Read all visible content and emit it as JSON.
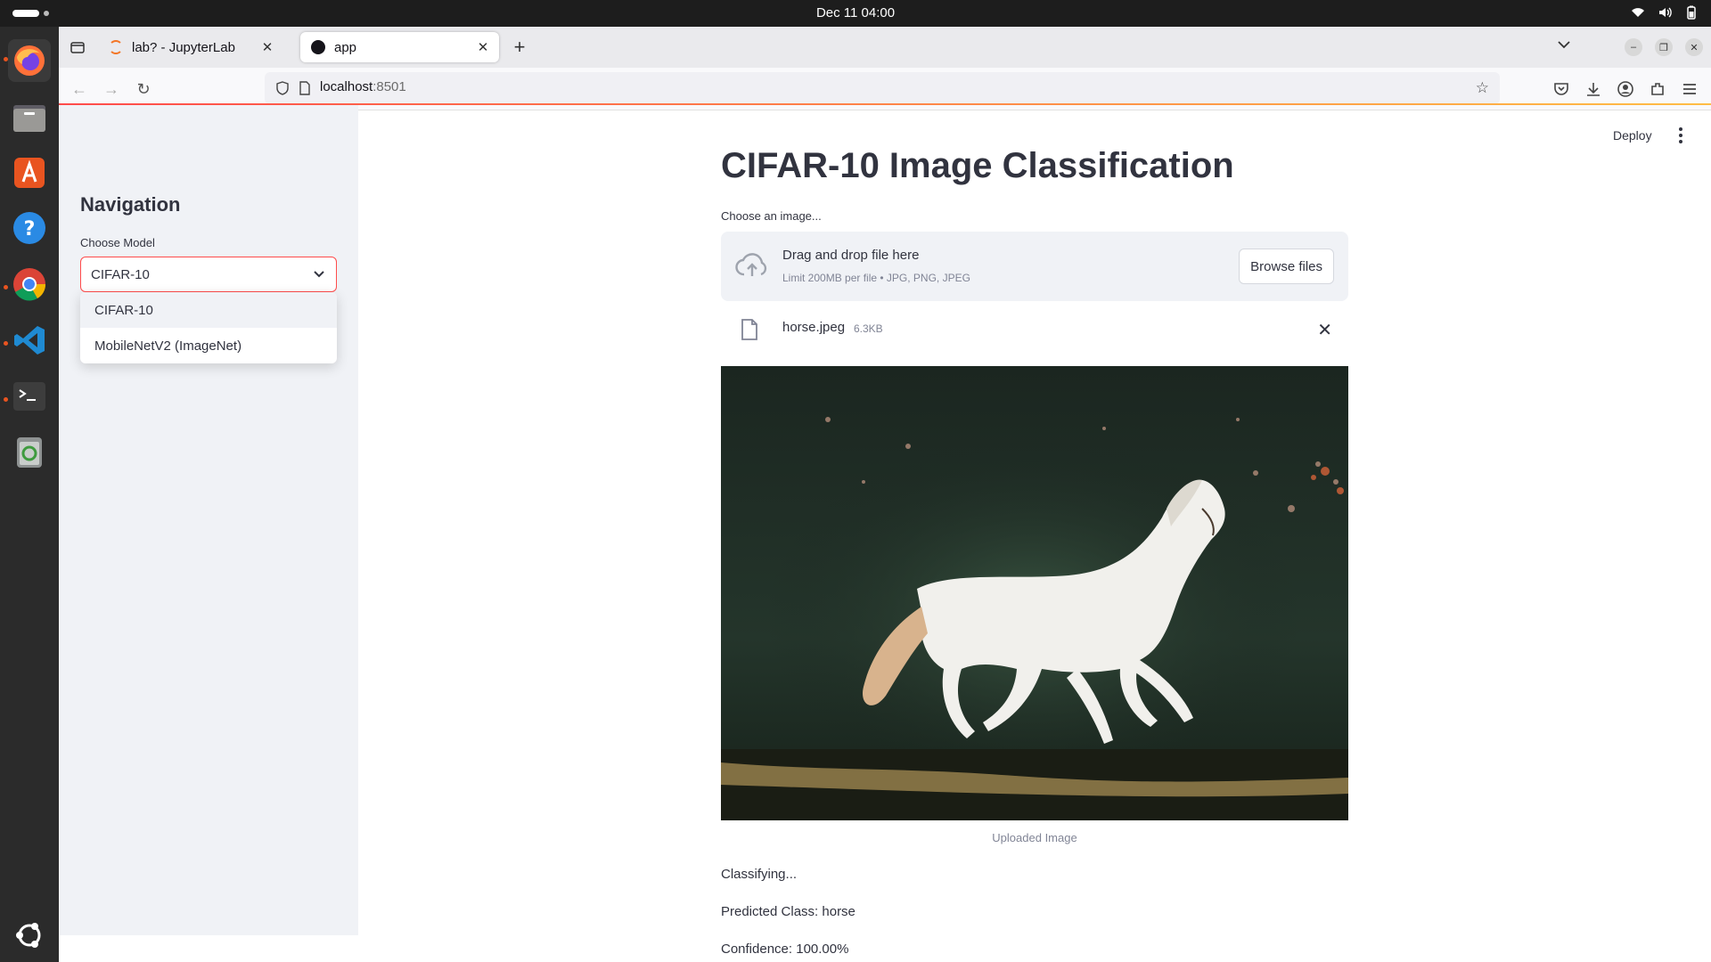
{
  "os": {
    "clock": "Dec 11  04:00"
  },
  "browser": {
    "tabs": [
      {
        "title": "lab? - JupyterLab",
        "favicon": "jupyter-icon"
      },
      {
        "title": "app",
        "favicon": "streamlit-icon"
      }
    ],
    "url_host": "localhost",
    "url_port": ":8501"
  },
  "sidebar": {
    "heading": "Navigation",
    "model_label": "Choose Model",
    "selected_model": "CIFAR-10",
    "options": [
      "CIFAR-10",
      "MobileNetV2 (ImageNet)"
    ]
  },
  "header": {
    "deploy_label": "Deploy"
  },
  "main": {
    "title": "CIFAR-10 Image Classification",
    "upload_label": "Choose an image...",
    "dropzone_title": "Drag and drop file here",
    "dropzone_sub": "Limit 200MB per file • JPG, PNG, JPEG",
    "browse_label": "Browse files",
    "file_name": "horse.jpeg",
    "file_size": "6.3KB",
    "image_caption": "Uploaded Image",
    "status": "Classifying...",
    "prediction": "Predicted Class: horse",
    "confidence": "Confidence: 100.00%"
  },
  "colors": {
    "accent": "#ff4b4b",
    "sidebar_bg": "#f0f2f6",
    "text": "#31333f"
  }
}
